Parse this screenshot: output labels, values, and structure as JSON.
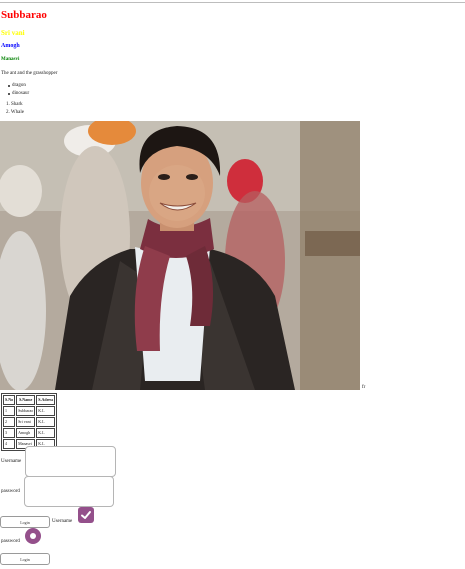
{
  "headings": {
    "h1": "Subbarao",
    "h2": "Sri vani",
    "h3": "Amogh",
    "h4": "Manasvi"
  },
  "paragraph": "The ant and the grasshopper",
  "unordered_list": [
    "dragon",
    "dinosaur"
  ],
  "ordered_list": [
    "1. Shark",
    "2. Whale"
  ],
  "image": {
    "description": "photo",
    "caption": "fr"
  },
  "table": {
    "headers": [
      "S.No",
      "S.Name",
      "S.Adress"
    ],
    "rows": [
      [
        "1",
        "Subbarao",
        "K.L"
      ],
      [
        "2",
        "Sri vani",
        "K.L"
      ],
      [
        "3",
        "Amogh",
        "K.L"
      ],
      [
        "4",
        "Manasvi",
        "K.L"
      ]
    ]
  },
  "form1": {
    "username_label": "Username",
    "password_label": "password",
    "username_value": "",
    "password_value": "",
    "button_label": "Login"
  },
  "form2": {
    "username_label": "Username",
    "password_label": "password",
    "checkbox_checked": true,
    "radio_checked": true,
    "button_label": "Login"
  },
  "colors": {
    "h1": "#ff0000",
    "h2": "#ffff00",
    "h3": "#0000ff",
    "h4": "#008000",
    "accent": "#94508b"
  },
  "icons": {
    "checkbox": "check-icon",
    "radio": "radio-dot-icon"
  }
}
